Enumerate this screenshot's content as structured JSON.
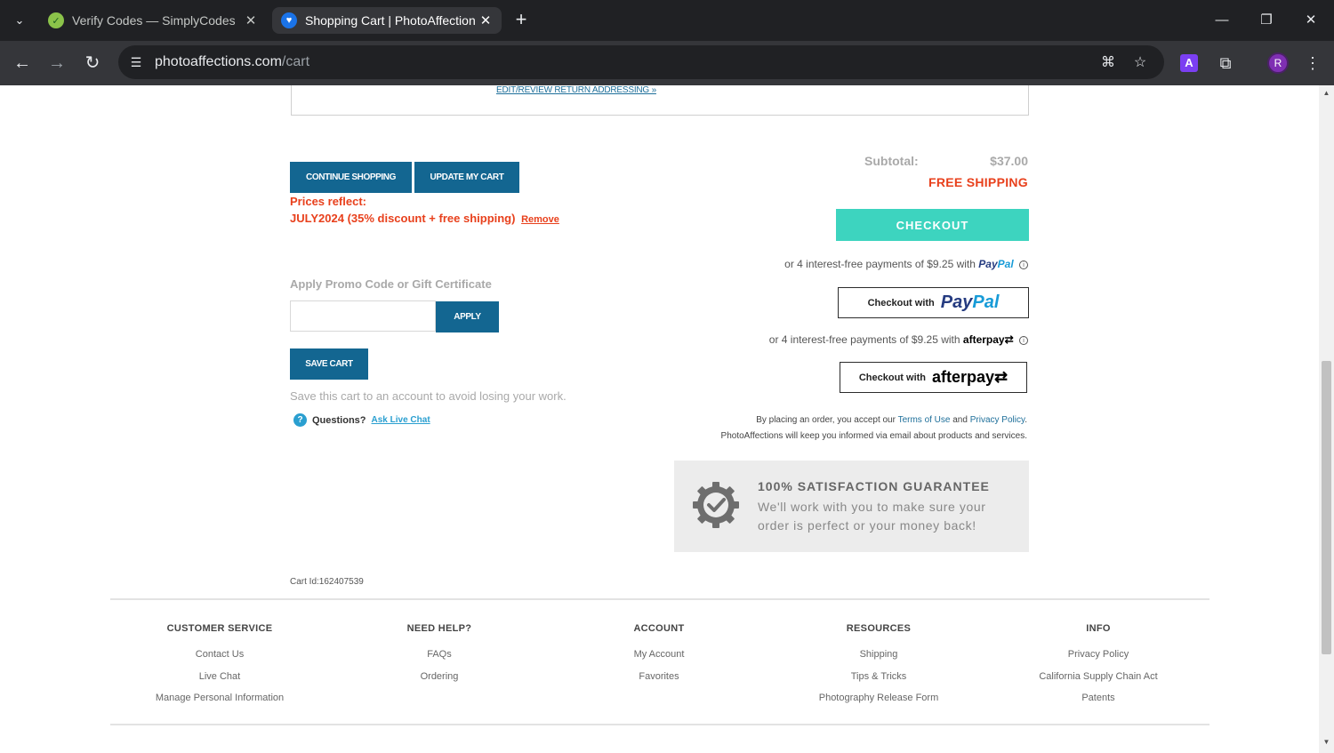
{
  "browser": {
    "tabs": [
      {
        "title": "Verify Codes — SimplyCodes",
        "active": false
      },
      {
        "title": "Shopping Cart | PhotoAffections",
        "active": true
      }
    ],
    "url_host": "photoaffections.com",
    "url_path": "/cart"
  },
  "cart": {
    "edit_return_link": "EDIT/REVIEW RETURN ADDRESSING »",
    "continue_shopping": "CONTINUE SHOPPING",
    "update_cart": "UPDATE MY CART",
    "prices_reflect": "Prices reflect:",
    "promo_applied": "JULY2024 (35% discount + free shipping)",
    "promo_remove": "Remove",
    "promo_label": "Apply Promo Code or Gift Certificate",
    "promo_placeholder": "",
    "apply": "APPLY",
    "save_cart": "SAVE CART",
    "save_hint": "Save this cart to an account to avoid losing your work.",
    "questions": "Questions?",
    "live_chat": "Ask Live Chat",
    "cart_id": "Cart Id:162407539"
  },
  "summary": {
    "subtotal_label": "Subtotal:",
    "subtotal_value": "$37.00",
    "free_shipping": "FREE SHIPPING",
    "checkout": "CHECKOUT",
    "paypal_note": "or 4 interest-free payments of $9.25 with",
    "paypal_pay": "Pay",
    "paypal_pal": "Pal",
    "checkout_with": "Checkout with",
    "afterpay_note": "or 4 interest-free payments of $9.25 with",
    "afterpay_word": "afterpay",
    "terms_prefix": "By placing an order, you accept our",
    "terms_of_use": "Terms of Use",
    "terms_and": "and",
    "privacy_policy": "Privacy Policy",
    "terms_suffix": ".",
    "email_note": "PhotoAffections will keep you informed via email about products and services.",
    "guarantee_title": "100% SATISFACTION GUARANTEE",
    "guarantee_text": "We'll work with you to make sure your order is perfect or your money back!"
  },
  "footer": {
    "columns": [
      {
        "heading": "CUSTOMER SERVICE",
        "links": [
          "Contact Us",
          "Live Chat",
          "Manage Personal Information"
        ]
      },
      {
        "heading": "NEED HELP?",
        "links": [
          "FAQs",
          "Ordering"
        ]
      },
      {
        "heading": "ACCOUNT",
        "links": [
          "My Account",
          "Favorites"
        ]
      },
      {
        "heading": "RESOURCES",
        "links": [
          "Shipping",
          "Tips & Tricks",
          "Photography Release Form"
        ]
      },
      {
        "heading": "INFO",
        "links": [
          "Privacy Policy",
          "California Supply Chain Act",
          "Patents"
        ]
      }
    ]
  },
  "colors": {
    "primary_button": "#136691",
    "checkout_button": "#3dd4bf",
    "promo_text": "#e8401c"
  }
}
